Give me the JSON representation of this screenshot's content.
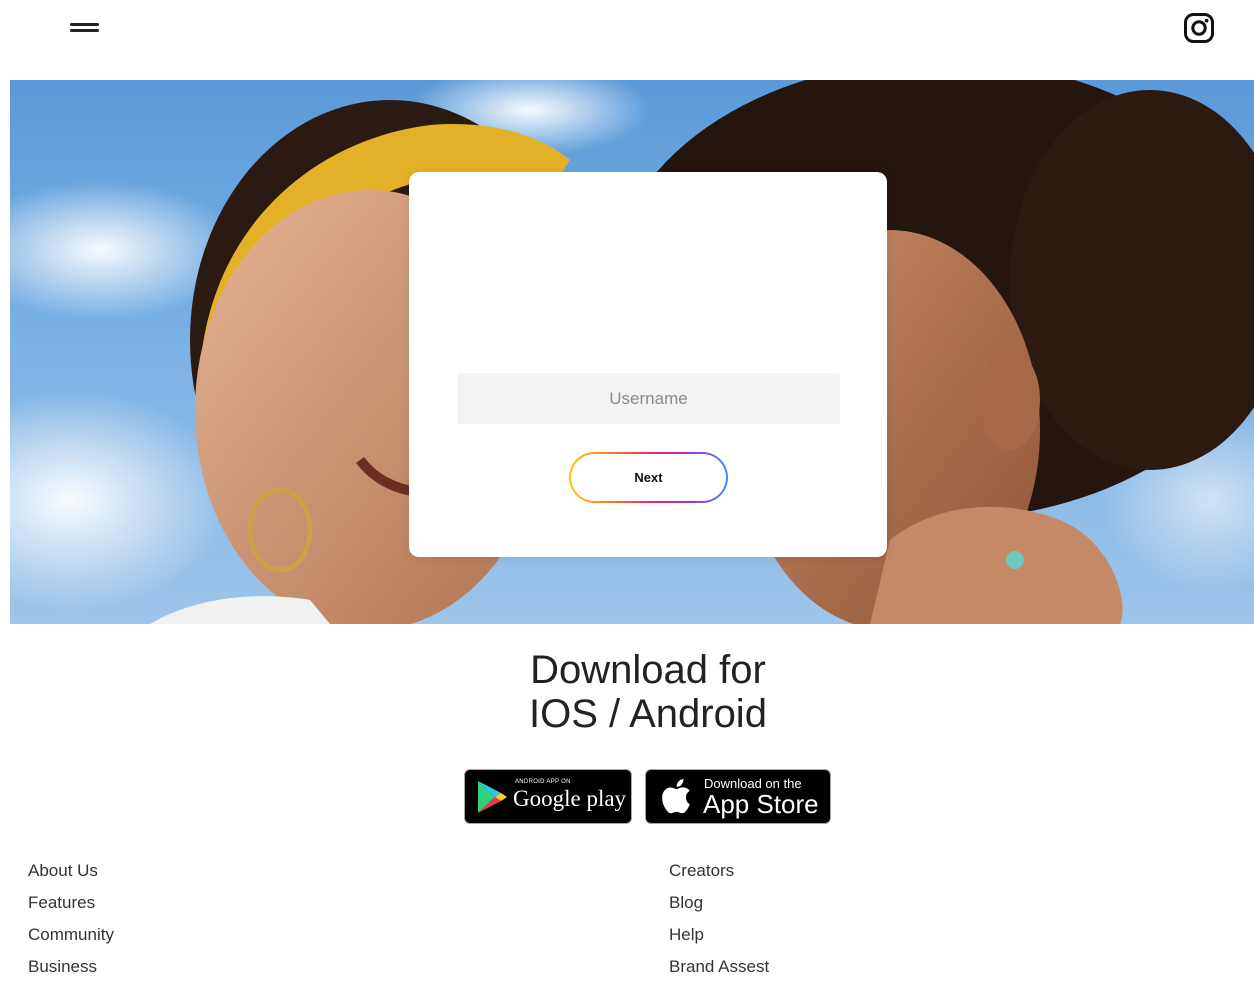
{
  "header": {
    "menu_icon": "hamburger-menu-icon",
    "social_icon": "instagram-icon"
  },
  "login": {
    "username_placeholder": "Username",
    "username_value": "",
    "next_label": "Next"
  },
  "download": {
    "heading_line1": "Download for",
    "heading_line2": "IOS / Android",
    "google_play": {
      "small_text": "ANDROID APP ON",
      "large_text": "Google play"
    },
    "app_store": {
      "small_text": "Download on the",
      "large_text": "App Store"
    }
  },
  "footer": {
    "left_links": [
      "About Us",
      "Features",
      "Community",
      "Business"
    ],
    "right_links": [
      "Creators",
      "Blog",
      "Help",
      "Brand Assest"
    ]
  },
  "colors": {
    "next_gradient": [
      "#ffc400",
      "#ff6a3d",
      "#e6236f",
      "#a533d6",
      "#3d8bff"
    ]
  }
}
